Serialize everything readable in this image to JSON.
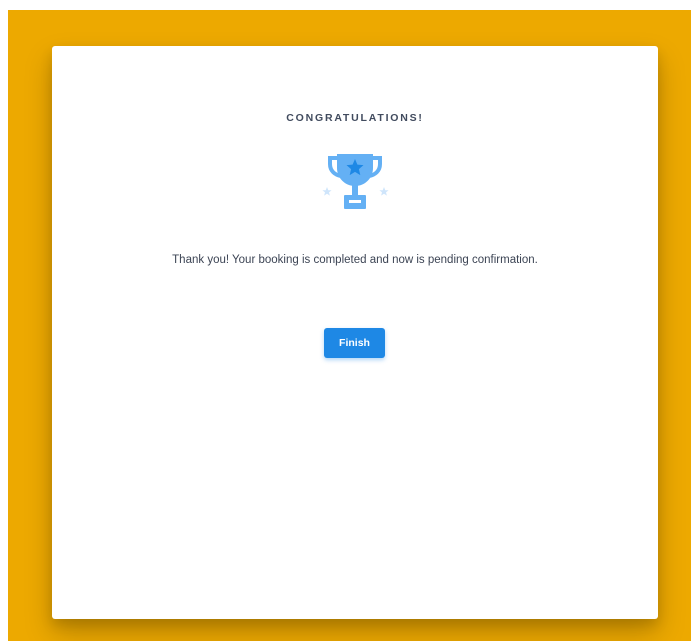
{
  "card": {
    "title": "CONGRATULATIONS!",
    "icon": "trophy-icon",
    "message": "Thank you! Your booking is completed and now is pending confirmation.",
    "finish_label": "Finish"
  },
  "colors": {
    "frame": "#eda900",
    "card": "#ffffff",
    "button": "#1e88e5",
    "trophy": "#64b0f4",
    "trophy_star": "#1e88e5",
    "sparkle": "#cfe5fb"
  }
}
